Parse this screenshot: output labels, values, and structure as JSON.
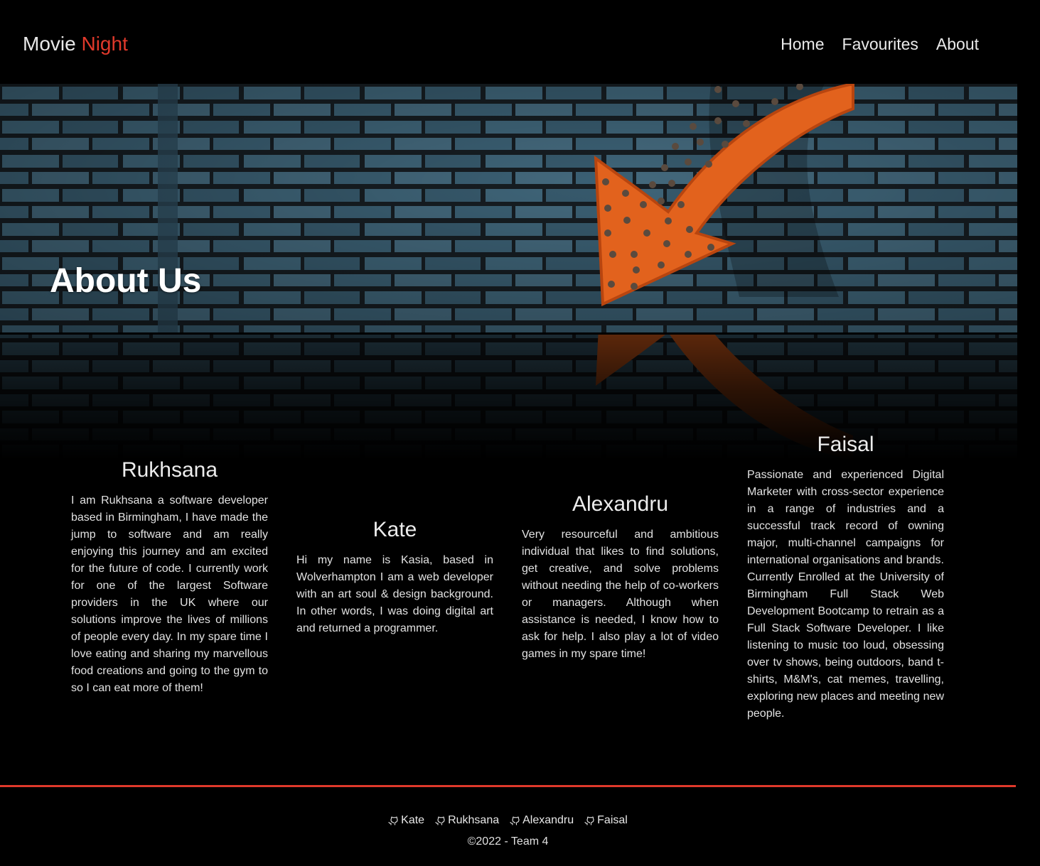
{
  "header": {
    "brand_primary": "Movie",
    "brand_accent": "Night",
    "nav": [
      "Home",
      "Favourites",
      "About"
    ]
  },
  "hero": {
    "title": "About Us"
  },
  "team": [
    {
      "name": "Rukhsana",
      "bio": "I am Rukhsana a software developer based in Birmingham, I have made the jump to software and am really enjoying this journey and am excited for the future of code. I currently work for one of the largest Software providers in the UK where our solutions improve the lives of millions of people every day. In my spare time I love eating and sharing my marvellous food creations and going to the gym to so I can eat more of them!"
    },
    {
      "name": "Kate",
      "bio": "Hi my name is Kasia, based in Wolverhampton I am a web developer with an art soul & design background. In other words, I was doing digital art and returned a programmer."
    },
    {
      "name": "Alexandru",
      "bio": "Very resourceful and ambitious individual that likes to find solutions, get creative, and solve problems without needing the help of co-workers or managers. Although when assistance is needed, I know how to ask for help. I also play a lot of video games in my spare time!"
    },
    {
      "name": "Faisal",
      "bio": "Passionate and experienced Digital Marketer with cross-sector experience in a range of industries and a successful track record of owning major, multi-channel campaigns for international organisations and brands. Currently Enrolled at the University of Birmingham Full Stack Web Development Bootcamp to retrain as a Full Stack Software Developer. I like listening to music too loud, obsessing over tv shows, being outdoors, band t-shirts, M&M's, cat memes, travelling, exploring new places and meeting new people."
    }
  ],
  "footer": {
    "links": [
      "Kate",
      "Rukhsana",
      "Alexandru",
      "Faisal"
    ],
    "link_icon": "github-icon",
    "copyright": "©2022 - Team 4"
  },
  "colors": {
    "accent": "#e0392b",
    "background": "#000000",
    "brick": "#3e6479"
  }
}
